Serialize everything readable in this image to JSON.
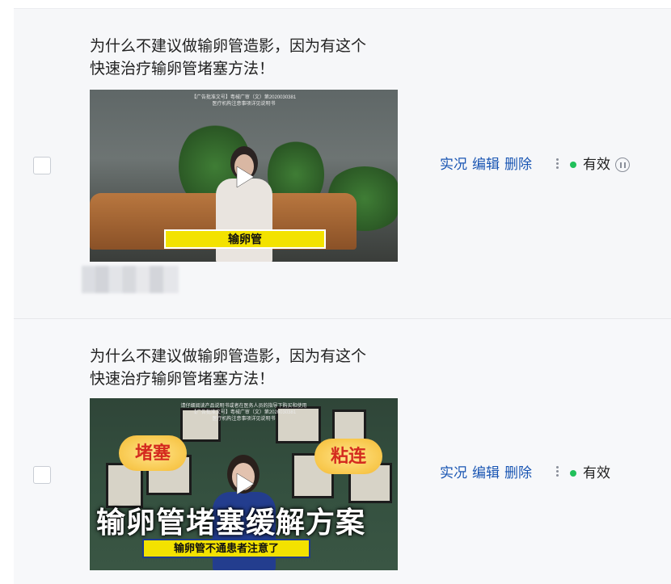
{
  "rows": [
    {
      "title_line1": "为什么不建议做输卵管造影，因为有这个",
      "title_line2": "快速治疗输卵管堵塞方法！",
      "thumbnail": {
        "notice_line1": "【广告批准文号】粤械广审（文）第2020030381",
        "notice_line2": "医疗机构注意事项详见说明书",
        "caption": "输卵管"
      },
      "actions": [
        "实况",
        "编辑",
        "删除"
      ],
      "status": "有效",
      "status_color": "#21c05a",
      "has_pause_icon": true
    },
    {
      "title_line1": "为什么不建议做输卵管造影，因为有这个",
      "title_line2": "快速治疗输卵管堵塞方法！",
      "thumbnail": {
        "notice_line1": "请仔细阅读产品说明书或者在医务人员的指导下购买和使用",
        "notice_line2": "【广告批准文号】粤械广审（文）第2020030381",
        "notice_line3": "医疗机构注意事项详见说明书",
        "sticker_left": "堵塞",
        "sticker_right": "粘连",
        "headline": "输卵管堵塞缓解方案",
        "caption": "输卵管不通患者注意了"
      },
      "actions": [
        "实况",
        "编辑",
        "删除"
      ],
      "status": "有效",
      "status_color": "#21c05a",
      "has_pause_icon": false
    }
  ]
}
